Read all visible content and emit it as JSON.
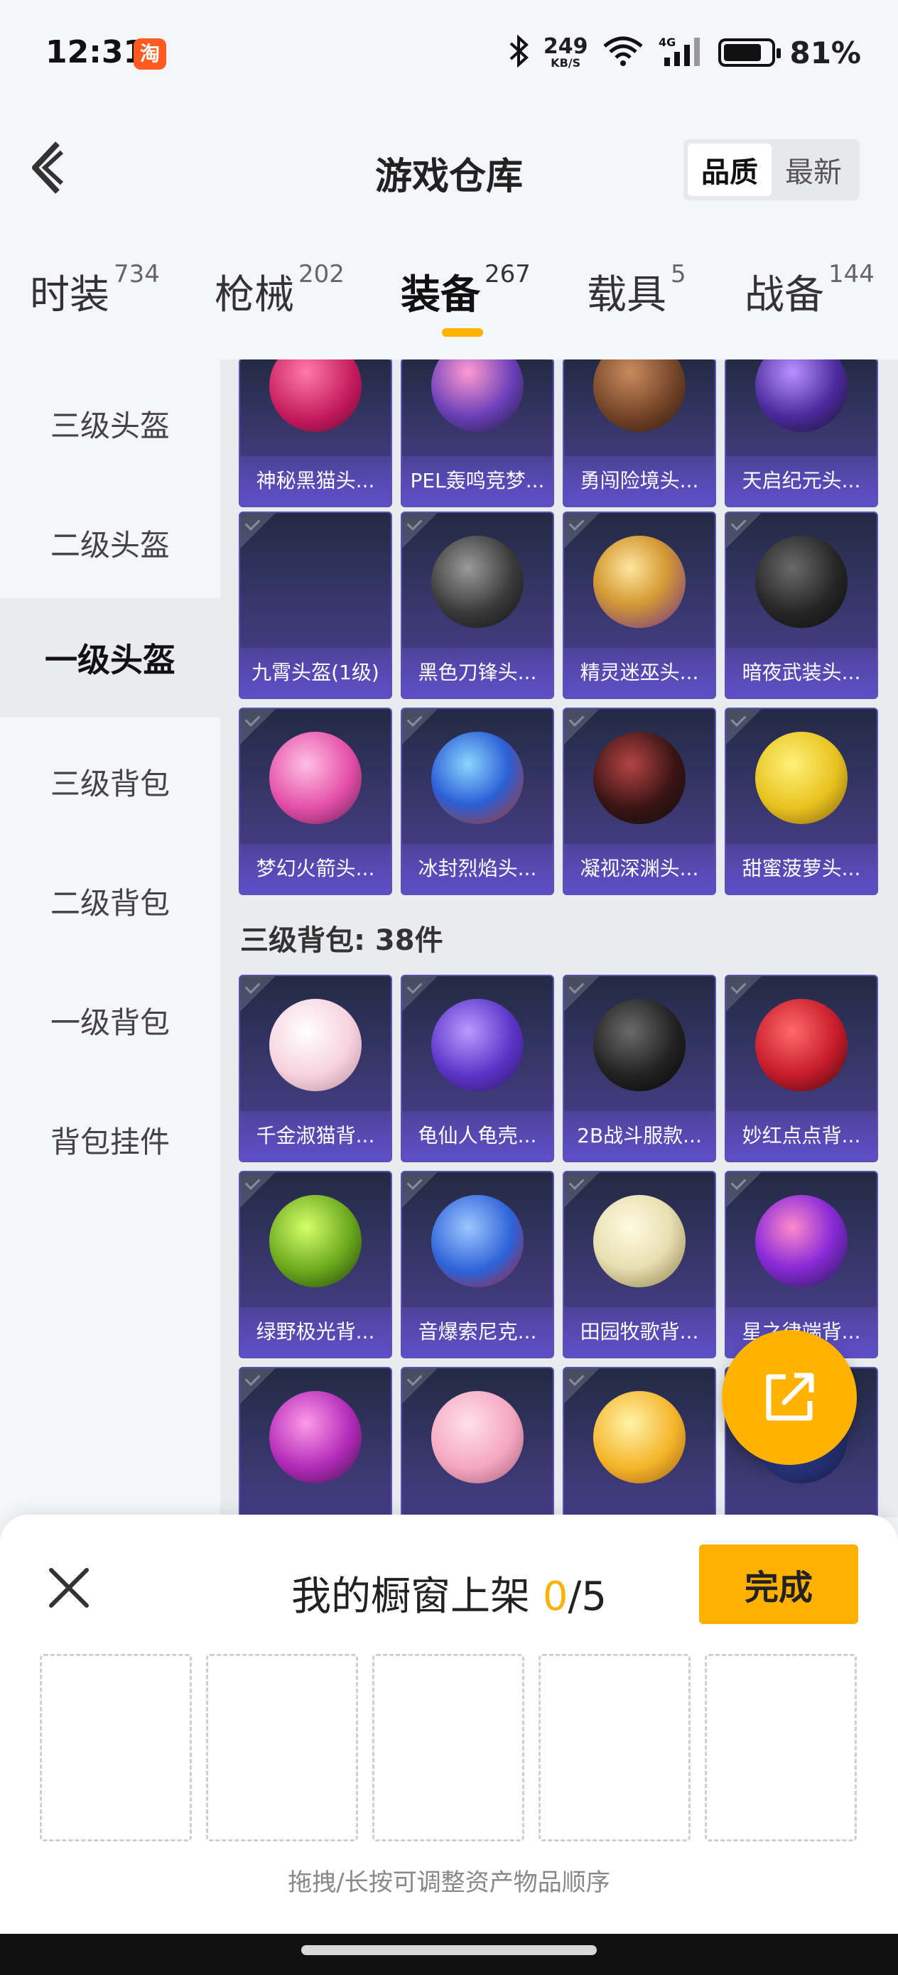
{
  "status": {
    "time": "12:31",
    "taobao_icon": "淘",
    "speed_num": "249",
    "speed_unit": "KB/S",
    "net": "4G",
    "battery": "81%",
    "battery_level": 0.81
  },
  "header": {
    "title": "游戏仓库",
    "sort_options": [
      "品质",
      "最新"
    ],
    "sort_selected": "品质"
  },
  "tabs": [
    {
      "label": "时装",
      "count": "734"
    },
    {
      "label": "枪械",
      "count": "202"
    },
    {
      "label": "装备",
      "count": "267"
    },
    {
      "label": "载具",
      "count": "5"
    },
    {
      "label": "战备",
      "count": "144"
    }
  ],
  "active_tab": "装备",
  "sidebar": [
    "三级头盔",
    "二级头盔",
    "一级头盔",
    "三级背包",
    "二级背包",
    "一级背包",
    "背包挂件"
  ],
  "sidebar_active": "一级头盔",
  "rows": {
    "row1": [
      "神秘黑猫头...",
      "PEL轰鸣竞梦...",
      "勇闯险境头...",
      "天启纪元头..."
    ],
    "row2": [
      "九霄头盔(1级)",
      "黑色刀锋头...",
      "精灵迷巫头...",
      "暗夜武装头..."
    ],
    "row3": [
      "梦幻火箭头...",
      "冰封烈焰头...",
      "凝视深渊头...",
      "甜蜜菠萝头..."
    ],
    "section": "三级背包: 38件",
    "row4": [
      "千金淑猫背...",
      "龟仙人龟壳...",
      "2B战斗服款...",
      "妙红点点背..."
    ],
    "row5": [
      "绿野极光背...",
      "音爆索尼克...",
      "田园牧歌背...",
      "星之律端背..."
    ]
  },
  "colors": {
    "accent": "#ffb100",
    "card_top": "#232a43",
    "card_bottom": "#4d3f96"
  },
  "sheet": {
    "title_prefix": "我的橱窗上架 ",
    "count": "0",
    "total": "/5",
    "done": "完成",
    "hint": "拖拽/长按可调整资产物品顺序"
  }
}
